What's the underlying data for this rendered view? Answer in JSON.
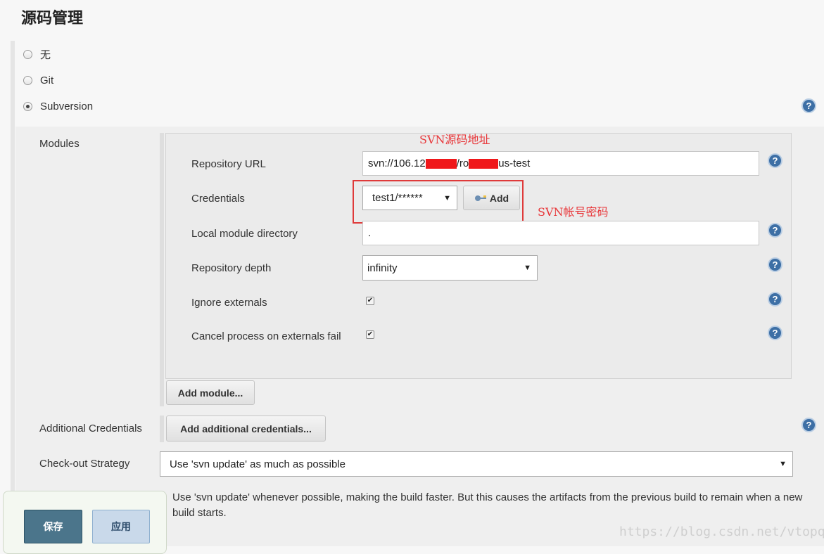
{
  "section": {
    "title": "源码管理"
  },
  "scm_options": [
    {
      "label": "无",
      "selected": false
    },
    {
      "label": "Git",
      "selected": false
    },
    {
      "label": "Subversion",
      "selected": true
    }
  ],
  "help_glyph": "?",
  "modules": {
    "label": "Modules",
    "repository_url": {
      "label": "Repository URL",
      "value_prefix": "svn://106.12",
      "value_mid": "/ro",
      "value_suffix": "us-test"
    },
    "credentials": {
      "label": "Credentials",
      "selected": "test1/******",
      "add_button": "Add"
    },
    "local_module_directory": {
      "label": "Local module directory",
      "value": "."
    },
    "repository_depth": {
      "label": "Repository depth",
      "selected": "infinity"
    },
    "ignore_externals": {
      "label": "Ignore externals",
      "checked": true
    },
    "cancel_process": {
      "label": "Cancel process on externals fail",
      "checked": true
    },
    "add_module_button": "Add module..."
  },
  "additional_credentials": {
    "label": "Additional Credentials",
    "button": "Add additional credentials..."
  },
  "checkout_strategy": {
    "label": "Check-out Strategy",
    "selected": "Use 'svn update' as much as possible",
    "description": "Use 'svn update' whenever possible, making the build faster. But this causes the artifacts from the previous build to remain when a new build starts."
  },
  "annotations": {
    "url_note": "SVN源码地址",
    "cred_note": "SVN帐号密码"
  },
  "actions": {
    "save": "保存",
    "apply": "应用"
  },
  "watermark": "https://blog.csdn.net/vtopqx",
  "colors": {
    "save_bg": "#4b758b",
    "apply_bg": "#c9d9ea",
    "annotation": "#e8383b",
    "help": "#3d6fa5"
  }
}
